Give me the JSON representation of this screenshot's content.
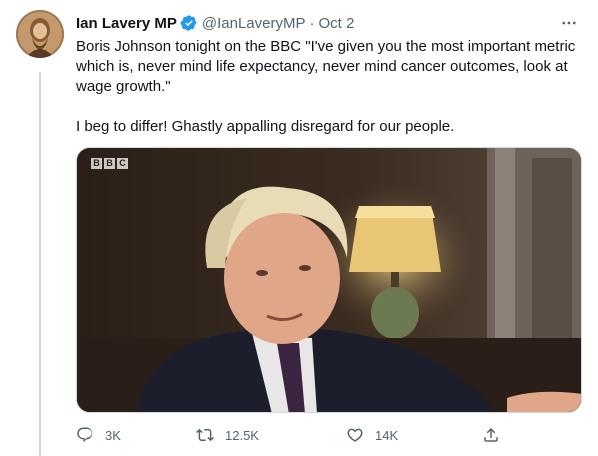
{
  "tweet": {
    "display_name": "Ian Lavery MP",
    "handle": "@IanLaveryMP",
    "separator": "·",
    "date": "Oct 2",
    "paragraphs": [
      "Boris Johnson tonight on the BBC \"I've given you the most important metric which is, never mind life expectancy, never mind cancer outcomes, look at wage growth.\"",
      "I beg to differ! Ghastly appalling disregard for our people."
    ],
    "media": {
      "watermark": [
        "B",
        "B",
        "C"
      ]
    },
    "actions": {
      "reply_count": "3K",
      "retweet_count": "12.5K",
      "like_count": "14K"
    }
  },
  "icons": {
    "verified": "verified-badge-icon",
    "more": "more-options-icon",
    "reply": "reply-icon",
    "retweet": "retweet-icon",
    "like": "heart-icon",
    "share": "share-icon"
  },
  "colors": {
    "accent": "#1d9bf0",
    "secondary_text": "#536471",
    "primary_text": "#0f1419",
    "thread_line": "#cfd9de"
  }
}
